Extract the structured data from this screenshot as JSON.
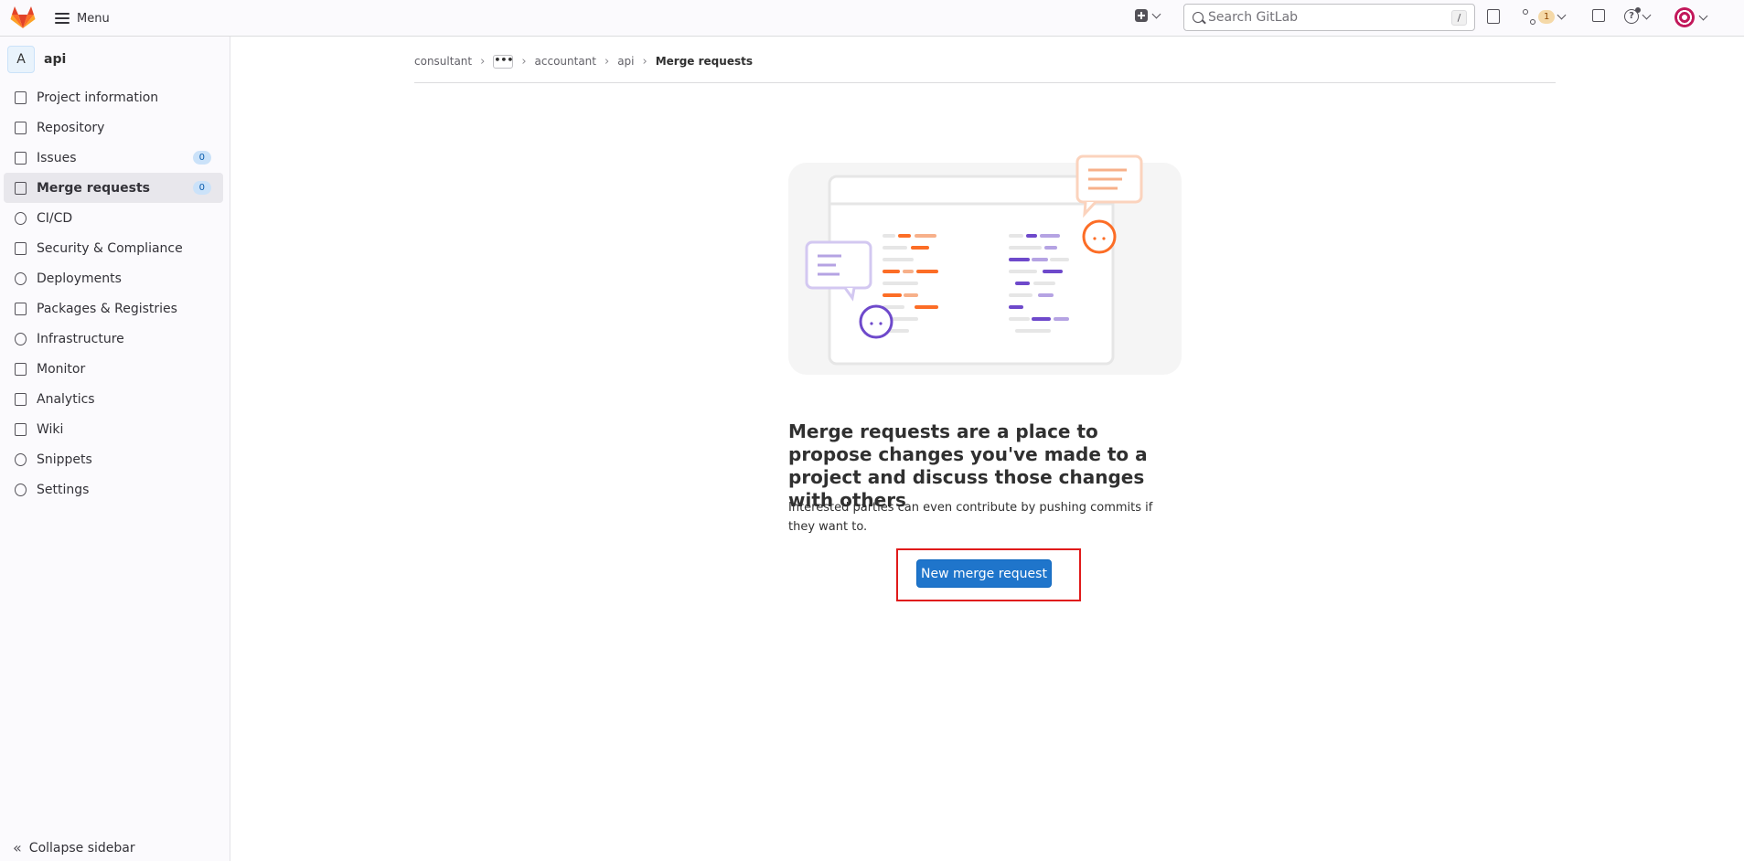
{
  "topbar": {
    "menu_label": "Menu",
    "search_placeholder": "Search GitLab",
    "search_shortcut": "/",
    "merge_requests_count": "1",
    "help_glyph": "?",
    "icons": [
      "gitlab-logo-icon",
      "hamburger-icon",
      "plus-square-icon",
      "chevron-down-icon",
      "search-icon",
      "issues-icon",
      "merge-request-icon",
      "todo-icon",
      "help-icon",
      "avatar"
    ]
  },
  "sidebar": {
    "project_initial": "A",
    "project_name": "api",
    "items": [
      {
        "label": "Project information",
        "icon": "project-icon"
      },
      {
        "label": "Repository",
        "icon": "document-icon"
      },
      {
        "label": "Issues",
        "icon": "issues-icon",
        "count": "0"
      },
      {
        "label": "Merge requests",
        "icon": "merge-request-icon",
        "count": "0",
        "active": true
      },
      {
        "label": "CI/CD",
        "icon": "rocket-icon"
      },
      {
        "label": "Security & Compliance",
        "icon": "shield-icon"
      },
      {
        "label": "Deployments",
        "icon": "deployments-icon"
      },
      {
        "label": "Packages & Registries",
        "icon": "package-icon"
      },
      {
        "label": "Infrastructure",
        "icon": "cloud-icon"
      },
      {
        "label": "Monitor",
        "icon": "monitor-icon"
      },
      {
        "label": "Analytics",
        "icon": "chart-icon"
      },
      {
        "label": "Wiki",
        "icon": "book-icon"
      },
      {
        "label": "Snippets",
        "icon": "scissors-icon"
      },
      {
        "label": "Settings",
        "icon": "gear-icon"
      }
    ],
    "collapse_label": "Collapse sidebar"
  },
  "breadcrumb": {
    "items": [
      "consultant",
      "accountant",
      "api"
    ],
    "ellipsis": "•••",
    "current": "Merge requests"
  },
  "empty_state": {
    "title": "Merge requests are a place to propose changes you've made to a project and discuss those changes with others",
    "description": "Interested parties can even contribute by pushing commits if they want to.",
    "button_label": "New merge request"
  },
  "colors": {
    "primary": "#1f75cb",
    "highlight": "#e01a1a",
    "orange": "#fc6d26",
    "purple": "#6e49cb"
  }
}
